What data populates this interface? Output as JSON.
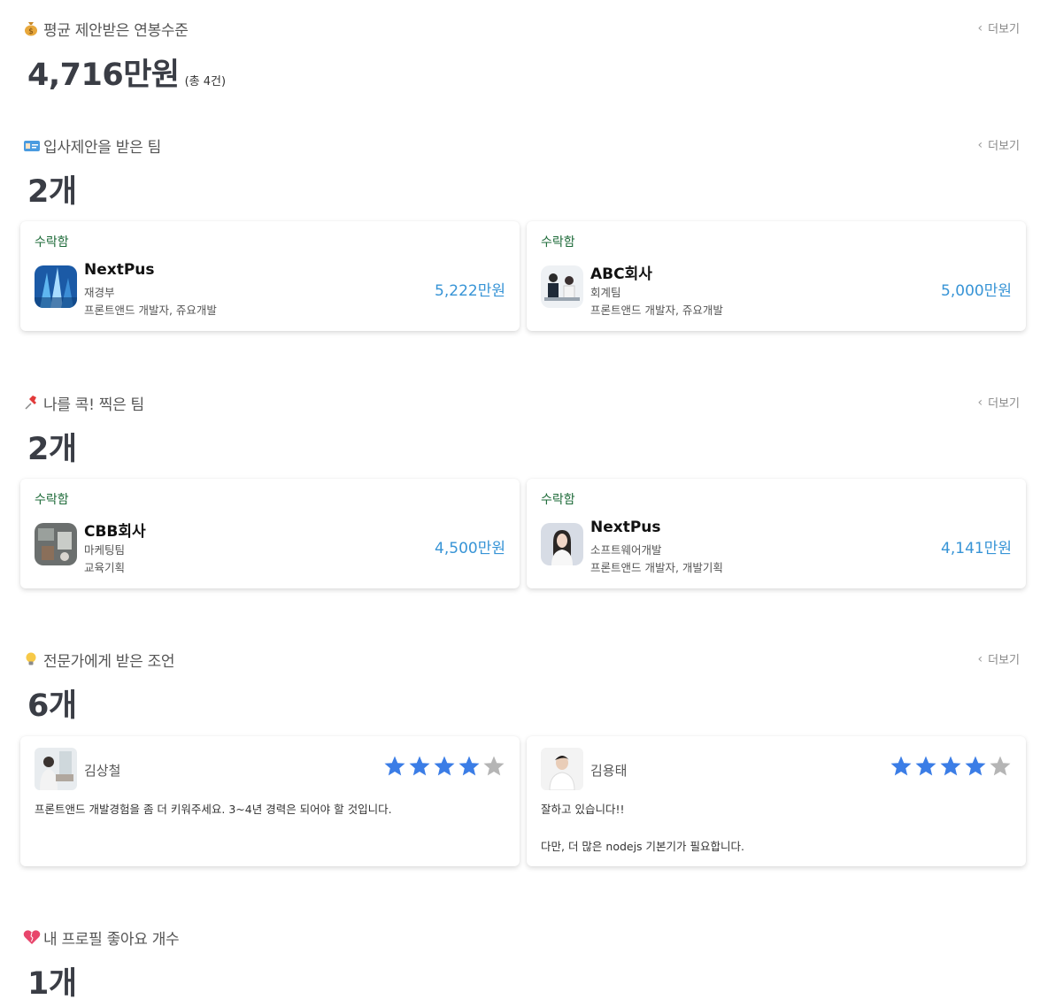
{
  "more_label": "더보기",
  "salary": {
    "title": "평균 제안받은 연봉수준",
    "value": "4,716만원",
    "count": "(총 4건)"
  },
  "offers": {
    "title": "입사제안을 받은 팀",
    "count": "2개",
    "cards": [
      {
        "status": "수락함",
        "company": "NextPus",
        "dept": "재경부",
        "role": "프론트앤드 개발자, 쥬요개발",
        "amount": "5,222만원"
      },
      {
        "status": "수락함",
        "company": "ABC회사",
        "dept": "회계팀",
        "role": "프론트앤드 개발자, 쥬요개발",
        "amount": "5,000만원"
      }
    ]
  },
  "picks": {
    "title": "나를 콕! 찍은 팀",
    "count": "2개",
    "cards": [
      {
        "status": "수락함",
        "company": "CBB회사",
        "dept": "마케팅팀",
        "role": "교육기획",
        "amount": "4,500만원"
      },
      {
        "status": "수락함",
        "company": "NextPus",
        "dept": "소프트웨어개발",
        "role": "프론트앤드 개발자, 개발기획",
        "amount": "4,141만원"
      }
    ]
  },
  "advice": {
    "title": "전문가에게 받은 조언",
    "count": "6개",
    "reviews": [
      {
        "name": "김상철",
        "rating": 4,
        "max": 5,
        "text": "프론트앤드 개발경험을 좀 더 키워주세요. 3~4년 경력은 되어야 할 것입니다."
      },
      {
        "name": "김용태",
        "rating": 4,
        "max": 5,
        "text": "잘하고 있습니다!!\n\n다만, 더 많은 nodejs 기본기가 필요합니다."
      }
    ]
  },
  "likes": {
    "title": "내 프로필 좋아요 개수",
    "count": "1개"
  },
  "colors": {
    "star_on": "#3b7de6",
    "star_off": "#b5b5b5",
    "accepted": "#1e6b39",
    "amount": "#3794d6"
  }
}
